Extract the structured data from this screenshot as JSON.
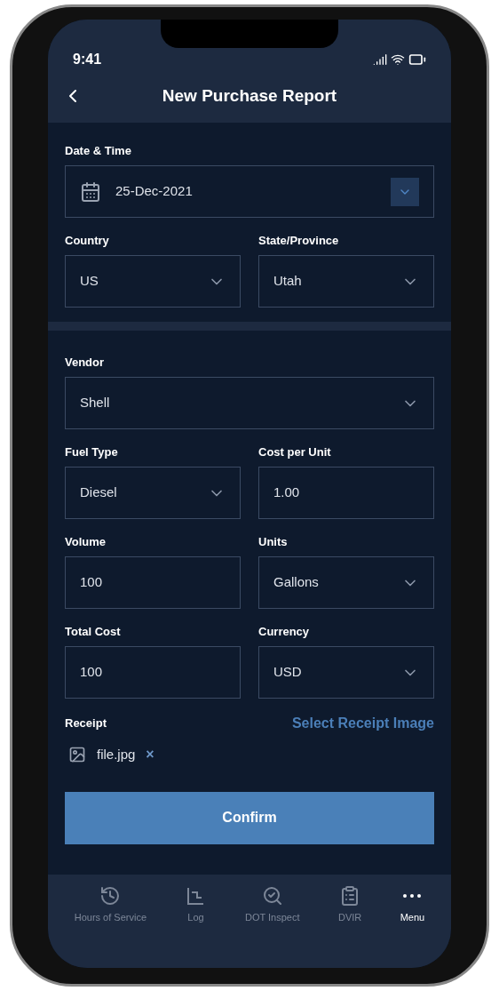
{
  "status_bar": {
    "time": "9:41"
  },
  "header": {
    "title": "New Purchase Report"
  },
  "sections": [
    {
      "rows": [
        [
          {
            "label": "Date & Time",
            "kind": "date",
            "value": "25-Dec-2021"
          }
        ],
        [
          {
            "label": "Country",
            "kind": "dropdown",
            "value": "US"
          },
          {
            "label": "State/Province",
            "kind": "dropdown",
            "value": "Utah"
          }
        ]
      ]
    },
    {
      "rows": [
        [
          {
            "label": "Vendor",
            "kind": "dropdown",
            "value": "Shell"
          }
        ],
        [
          {
            "label": "Fuel Type",
            "kind": "dropdown",
            "value": "Diesel"
          },
          {
            "label": "Cost per Unit",
            "kind": "text",
            "value": "1.00"
          }
        ],
        [
          {
            "label": "Volume",
            "kind": "text",
            "value": "100"
          },
          {
            "label": "Units",
            "kind": "dropdown",
            "value": "Gallons"
          }
        ],
        [
          {
            "label": "Total Cost",
            "kind": "text",
            "value": "100"
          },
          {
            "label": "Currency",
            "kind": "dropdown",
            "value": "USD"
          }
        ]
      ]
    }
  ],
  "receipt": {
    "label": "Receipt",
    "action": "Select Receipt Image",
    "file": "file.jpg",
    "remove": "×"
  },
  "confirm_button": "Confirm",
  "bottom_nav": [
    {
      "label": "Hours of Service",
      "kind": "history",
      "selected": false
    },
    {
      "label": "Log",
      "kind": "log",
      "selected": false
    },
    {
      "label": "DOT Inspect",
      "kind": "inspect",
      "selected": false
    },
    {
      "label": "DVIR",
      "kind": "dvir",
      "selected": false
    },
    {
      "label": "Menu",
      "kind": "menu",
      "selected": true
    }
  ]
}
